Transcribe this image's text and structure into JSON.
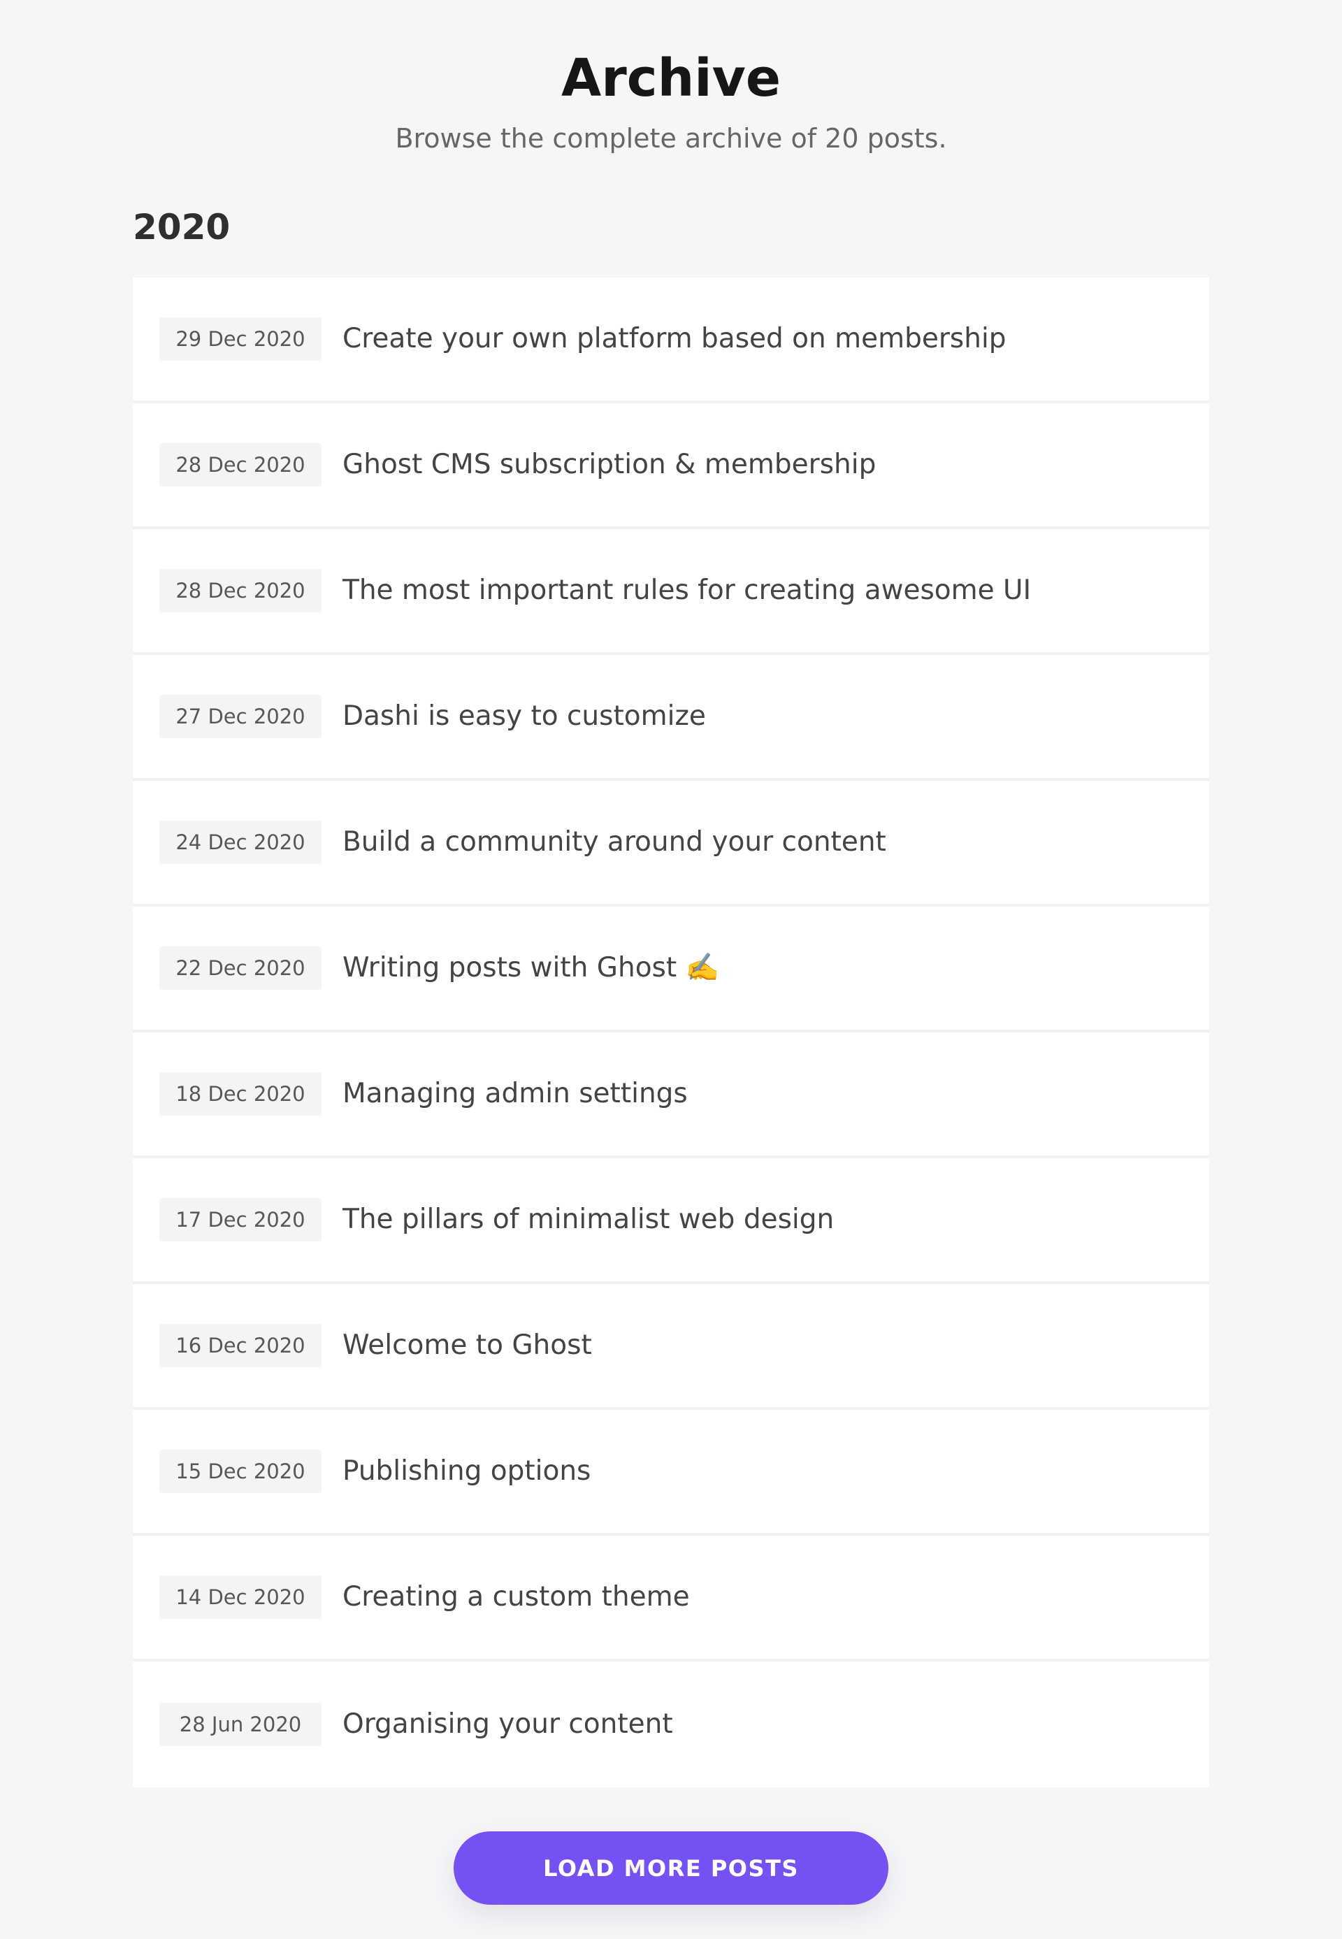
{
  "header": {
    "title": "Archive",
    "subtitle": "Browse the complete archive of 20 posts."
  },
  "year_group": {
    "year": "2020",
    "posts": [
      {
        "date": "29 Dec 2020",
        "title": "Create your own platform based on membership"
      },
      {
        "date": "28 Dec 2020",
        "title": "Ghost CMS subscription & membership"
      },
      {
        "date": "28 Dec 2020",
        "title": "The most important rules for creating awesome UI"
      },
      {
        "date": "27 Dec 2020",
        "title": "Dashi is easy to customize"
      },
      {
        "date": "24 Dec 2020",
        "title": "Build a community around your content"
      },
      {
        "date": "22 Dec 2020",
        "title": "Writing posts with Ghost ✍️"
      },
      {
        "date": "18 Dec 2020",
        "title": "Managing admin settings"
      },
      {
        "date": "17 Dec 2020",
        "title": "The pillars of minimalist web design"
      },
      {
        "date": "16 Dec 2020",
        "title": "Welcome to Ghost"
      },
      {
        "date": "15 Dec 2020",
        "title": "Publishing options"
      },
      {
        "date": "14 Dec 2020",
        "title": "Creating a custom theme"
      },
      {
        "date": "28 Jun 2020",
        "title": "Organising your content"
      }
    ]
  },
  "load_more": {
    "label": "Load more posts"
  },
  "colors": {
    "background": "#f5f6f8",
    "card": "#ffffff",
    "accent": "#7551f4",
    "badge_bg": "#f4f4f5"
  }
}
